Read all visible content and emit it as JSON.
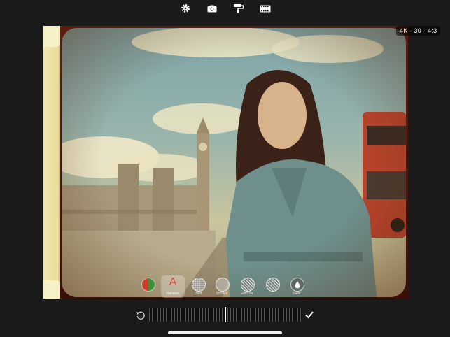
{
  "toolbar": {
    "icons": [
      "gear-icon",
      "camera-icon",
      "paint-roller-icon",
      "film-icon"
    ]
  },
  "viewfinder": {
    "format_badge": "4K · 30 · 4:3"
  },
  "filters": [
    {
      "label": "",
      "icon": "color-swatch-icon",
      "selected": false
    },
    {
      "label": "Halation",
      "icon": "halation-icon",
      "selected": true
    },
    {
      "label": "Dust",
      "icon": "dust-icon",
      "selected": false
    },
    {
      "label": "Scratch",
      "icon": "scratch-icon",
      "selected": false
    },
    {
      "label": "Film Str",
      "icon": "film-strength-icon",
      "selected": false
    },
    {
      "label": "",
      "icon": "grain-icon",
      "selected": false
    },
    {
      "label": "Fade",
      "icon": "drop-icon",
      "selected": false
    }
  ],
  "adjuster": {
    "reset_icon": "reset-icon",
    "confirm_icon": "checkmark-icon",
    "level": 0.5
  },
  "colors": {
    "background": "#1a1a1a",
    "accent_red": "#e04040",
    "film_edge": "#f2e7b0"
  }
}
